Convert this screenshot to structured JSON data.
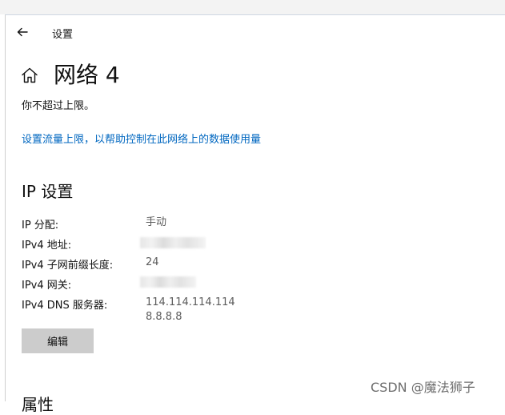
{
  "window": {
    "title": "设置"
  },
  "page": {
    "title": "网络 4",
    "status": "你不超过上限。",
    "data_limit_link": "设置流量上限，以帮助控制在此网络上的数据使用量"
  },
  "ip_section": {
    "title": "IP 设置",
    "rows": [
      {
        "label": "IP 分配:",
        "value": "手动"
      },
      {
        "label": "IPv4 地址:",
        "value": ""
      },
      {
        "label": "IPv4 子网前缀长度:",
        "value": "24"
      },
      {
        "label": "IPv4 网关:",
        "value": ""
      },
      {
        "label": "IPv4 DNS 服务器:",
        "values": [
          "114.114.114.114",
          "8.8.8.8"
        ]
      }
    ],
    "edit_label": "编辑"
  },
  "properties_section": {
    "title": "属性"
  },
  "watermark": "CSDN @魔法狮子",
  "icons": {
    "back": "back-arrow-icon",
    "home": "home-icon"
  },
  "colors": {
    "link": "#0067c0",
    "button": "#cccccc"
  }
}
